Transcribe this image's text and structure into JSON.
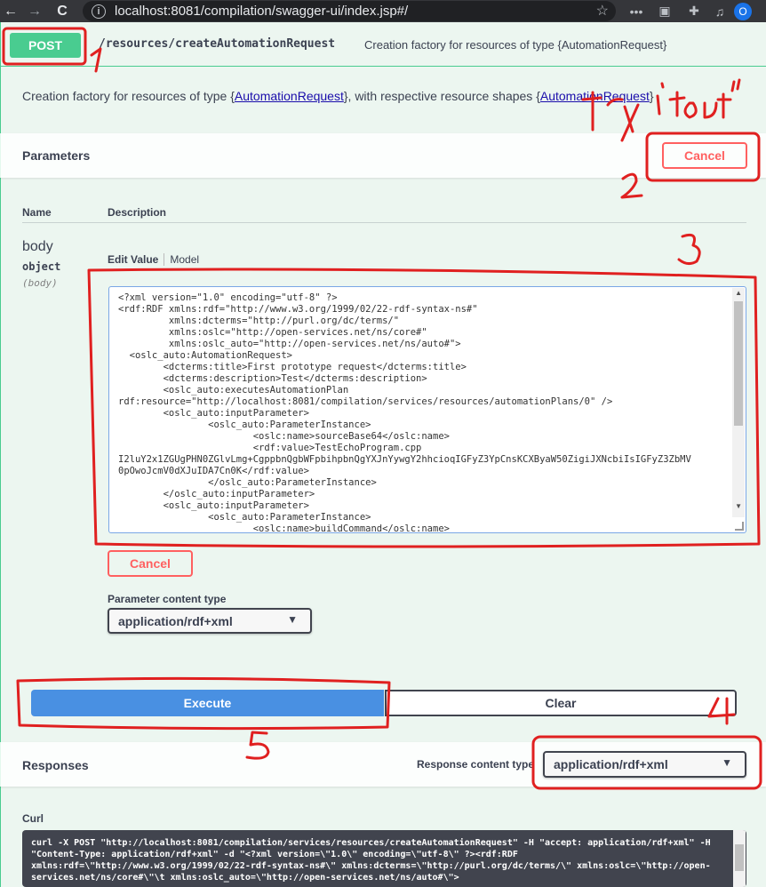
{
  "browser": {
    "url": "localhost:8081/compilation/swagger-ui/index.jsp#/",
    "back": "←",
    "forward": "→",
    "reload": "C",
    "profile_initial": "O"
  },
  "operation": {
    "method": "POST",
    "path": "/resources/createAutomationRequest",
    "summary": "Creation factory for resources of type {AutomationRequest}",
    "description_prefix": "Creation factory for resources of type {",
    "description_link1": "AutomationRequest",
    "description_middle": "}, with respective resource shapes {",
    "description_link2": "AutomationRequest",
    "description_suffix": "}"
  },
  "parameters": {
    "title": "Parameters",
    "cancel_label": "Cancel",
    "col_name": "Name",
    "col_description": "Description",
    "name": "body",
    "type": "object",
    "in": "(body)",
    "tab_edit": "Edit Value",
    "tab_model": "Model",
    "body_value": "<?xml version=\"1.0\" encoding=\"utf-8\" ?>\n<rdf:RDF xmlns:rdf=\"http://www.w3.org/1999/02/22-rdf-syntax-ns#\"\n         xmlns:dcterms=\"http://purl.org/dc/terms/\"\n         xmlns:oslc=\"http://open-services.net/ns/core#\"\n         xmlns:oslc_auto=\"http://open-services.net/ns/auto#\">\n  <oslc_auto:AutomationRequest>\n        <dcterms:title>First prototype request</dcterms:title>\n        <dcterms:description>Test</dcterms:description>\n        <oslc_auto:executesAutomationPlan\nrdf:resource=\"http://localhost:8081/compilation/services/resources/automationPlans/0\" />\n        <oslc_auto:inputParameter>\n                <oslc_auto:ParameterInstance>\n                        <oslc:name>sourceBase64</oslc:name>\n                        <rdf:value>TestEchoProgram.cpp\nI2luY2x1ZGUgPHN0ZGlvLmg+CgppbnQgbWFpbihpbnQgYXJnYywgY2hhcioqIGFyZ3YpCnsKCXByaW50ZigiJXNcbiIsIGFyZ3ZbMV\n0pOwoJcmV0dXJuIDA7Cn0K</rdf:value>\n                </oslc_auto:ParameterInstance>\n        </oslc_auto:inputParameter>\n        <oslc_auto:inputParameter>\n                <oslc_auto:ParameterInstance>\n                        <oslc:name>buildCommand</oslc:name>",
    "cancel_small_label": "Cancel",
    "content_type_label": "Parameter content type",
    "content_type_value": "application/rdf+xml"
  },
  "actions": {
    "execute_label": "Execute",
    "clear_label": "Clear"
  },
  "responses": {
    "title": "Responses",
    "content_type_label": "Response content type",
    "content_type_value": "application/rdf+xml",
    "curl_label": "Curl",
    "curl_value": "curl -X POST \"http://localhost:8081/compilation/services/resources/createAutomationRequest\" -H \"accept: application/rdf+xml\" -H \"Content-Type: application/rdf+xml\" -d \"<?xml version=\\\"1.0\\\" encoding=\\\"utf-8\\\" ?><rdf:RDF xmlns:rdf=\\\"http://www.w3.org/1999/02/22-rdf-syntax-ns#\\\" xmlns:dcterms=\\\"http://purl.org/dc/terms/\\\" xmlns:oslc=\\\"http://open-services.net/ns/core#\\\"\\t xmlns:oslc_auto=\\\"http://open-services.net/ns/auto#\\\">"
  },
  "annotations": {
    "try_it_out": "\"try it out\"",
    "n1": "1",
    "n2": "2",
    "n3": "3",
    "n4": "4",
    "n5": "5",
    "color": "#e02020"
  },
  "colors": {
    "post_green": "#49cc90",
    "execute_blue": "#4990e2",
    "cancel_red": "#ff6060",
    "code_bg": "#41444e"
  }
}
